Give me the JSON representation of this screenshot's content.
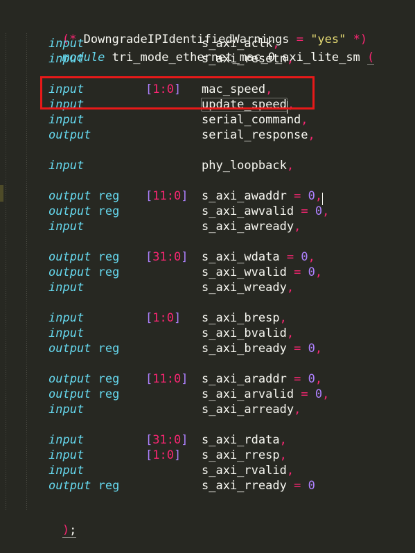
{
  "editor": {
    "background_color": "#272822",
    "foreground_color": "#f8f8f2",
    "language": "verilog",
    "font_size_px": 17,
    "line_height_px": 22
  },
  "annotation": {
    "type": "rectangle",
    "color": "#e81919",
    "covers_lines": [
      4,
      5
    ]
  },
  "change_marker": {
    "color": "#4e4b28"
  },
  "selection": {
    "highlighted_word": "update_speed",
    "highlight_border_color": "#74756f"
  },
  "code": {
    "line1": {
      "attr_open": "(*",
      "attr_name": "DowngradeIPIdentifiedWarnings",
      "equals": "=",
      "attr_value": "\"yes\"",
      "attr_close": "*)"
    },
    "line2": {
      "keyword": "module",
      "module_name": "tri_mode_ethernet_mac_0_axi_lite_sm",
      "paren": "("
    },
    "ports": [
      {
        "direction": "input",
        "width": "",
        "name": "s_axi_aclk",
        "assign": "",
        "comma": ","
      },
      {
        "direction": "input",
        "width": "",
        "name": "s_axi_resetn",
        "assign": "",
        "comma": ","
      },
      {
        "direction": "",
        "width": "",
        "name": "",
        "assign": "",
        "comma": ""
      },
      {
        "direction": "input",
        "width": "[1:0]",
        "name": "mac_speed",
        "assign": "",
        "comma": ","
      },
      {
        "direction": "input",
        "width": "",
        "name": "update_speed",
        "assign": "",
        "comma": ","
      },
      {
        "direction": "input",
        "width": "",
        "name": "serial_command",
        "assign": "",
        "comma": ","
      },
      {
        "direction": "output",
        "width": "",
        "name": "serial_response",
        "assign": "",
        "comma": ","
      },
      {
        "direction": "",
        "width": "",
        "name": "",
        "assign": "",
        "comma": ""
      },
      {
        "direction": "input",
        "width": "",
        "name": "phy_loopback",
        "assign": "",
        "comma": ","
      },
      {
        "direction": "",
        "width": "",
        "name": "",
        "assign": "",
        "comma": ""
      },
      {
        "direction": "output reg",
        "width": "[11:0]",
        "name": "s_axi_awaddr",
        "assign": "= 0",
        "comma": ","
      },
      {
        "direction": "output reg",
        "width": "",
        "name": "s_axi_awvalid",
        "assign": "= 0",
        "comma": ","
      },
      {
        "direction": "input",
        "width": "",
        "name": "s_axi_awready",
        "assign": "",
        "comma": ","
      },
      {
        "direction": "",
        "width": "",
        "name": "",
        "assign": "",
        "comma": ""
      },
      {
        "direction": "output reg",
        "width": "[31:0]",
        "name": "s_axi_wdata",
        "assign": "= 0",
        "comma": ","
      },
      {
        "direction": "output reg",
        "width": "",
        "name": "s_axi_wvalid",
        "assign": "= 0",
        "comma": ","
      },
      {
        "direction": "input",
        "width": "",
        "name": "s_axi_wready",
        "assign": "",
        "comma": ","
      },
      {
        "direction": "",
        "width": "",
        "name": "",
        "assign": "",
        "comma": ""
      },
      {
        "direction": "input",
        "width": "[1:0]",
        "name": "s_axi_bresp",
        "assign": "",
        "comma": ","
      },
      {
        "direction": "input",
        "width": "",
        "name": "s_axi_bvalid",
        "assign": "",
        "comma": ","
      },
      {
        "direction": "output reg",
        "width": "",
        "name": "s_axi_bready",
        "assign": "= 0",
        "comma": ","
      },
      {
        "direction": "",
        "width": "",
        "name": "",
        "assign": "",
        "comma": ""
      },
      {
        "direction": "output reg",
        "width": "[11:0]",
        "name": "s_axi_araddr",
        "assign": "= 0",
        "comma": ","
      },
      {
        "direction": "output reg",
        "width": "",
        "name": "s_axi_arvalid",
        "assign": "= 0",
        "comma": ","
      },
      {
        "direction": "input",
        "width": "",
        "name": "s_axi_arready",
        "assign": "",
        "comma": ","
      },
      {
        "direction": "",
        "width": "",
        "name": "",
        "assign": "",
        "comma": ""
      },
      {
        "direction": "input",
        "width": "[31:0]",
        "name": "s_axi_rdata",
        "assign": "",
        "comma": ","
      },
      {
        "direction": "input",
        "width": "[1:0]",
        "name": "s_axi_rresp",
        "assign": "",
        "comma": ","
      },
      {
        "direction": "input",
        "width": "",
        "name": "s_axi_rvalid",
        "assign": "",
        "comma": ","
      },
      {
        "direction": "output reg",
        "width": "",
        "name": "s_axi_rready",
        "assign": "= 0",
        "comma": ""
      }
    ],
    "line_last": {
      "paren": ")",
      "semicolon": ";"
    }
  }
}
